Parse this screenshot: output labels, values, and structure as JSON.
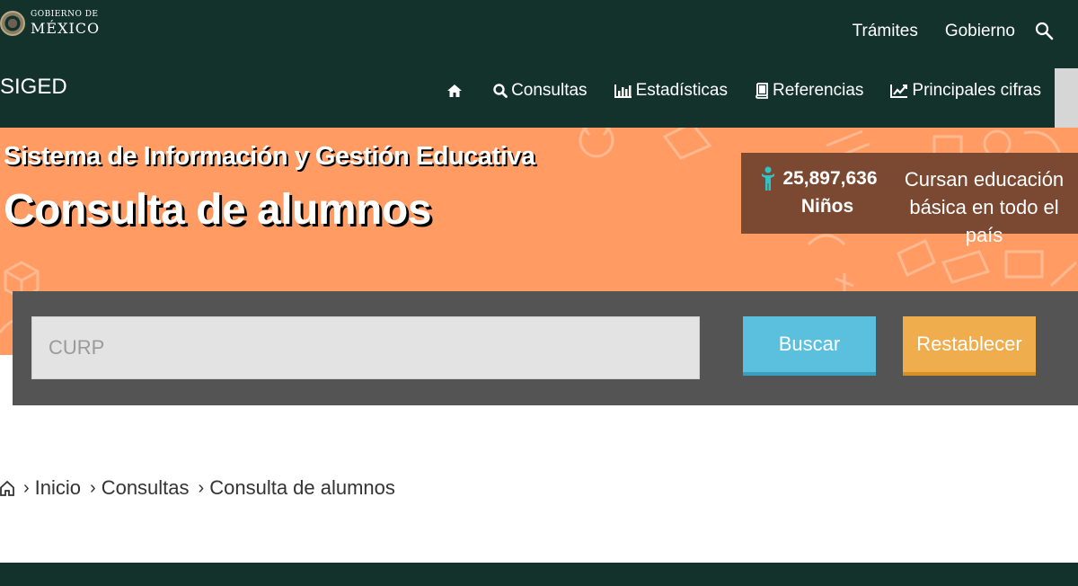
{
  "header": {
    "logo": {
      "line1": "GOBIERNO DE",
      "line2": "MÉXICO"
    },
    "links": [
      "Trámites",
      "Gobierno"
    ],
    "search_icon": "search-icon"
  },
  "navbar": {
    "brand": "SIGED",
    "home_icon": "home-icon",
    "items": [
      {
        "label": "Consultas",
        "icon": "search-icon"
      },
      {
        "label": "Estadísticas",
        "icon": "bar-chart-icon"
      },
      {
        "label": "Referencias",
        "icon": "book-icon"
      },
      {
        "label": "Principales cifras",
        "icon": "line-chart-icon"
      }
    ]
  },
  "hero": {
    "subtitle": "Sistema de Información y Gestión Educativa",
    "title": "Consulta de alumnos",
    "stat": {
      "number": "25,897,636",
      "unit": "Niños",
      "description": "Cursan educación básica en todo el país",
      "icon": "child-icon"
    }
  },
  "search": {
    "placeholder": "CURP",
    "value": "",
    "buscar_label": "Buscar",
    "restablecer_label": "Restablecer"
  },
  "breadcrumb": {
    "home_icon": "home-icon",
    "items": [
      "Inicio",
      "Consultas",
      "Consulta de alumnos"
    ]
  },
  "colors": {
    "header_bg": "#13322b",
    "hero_bg": "#ff9b63",
    "stat_bg": "#7b4932",
    "panel_bg": "#545454",
    "buscar": "#5bc0de",
    "restablecer": "#f0ad4e"
  }
}
